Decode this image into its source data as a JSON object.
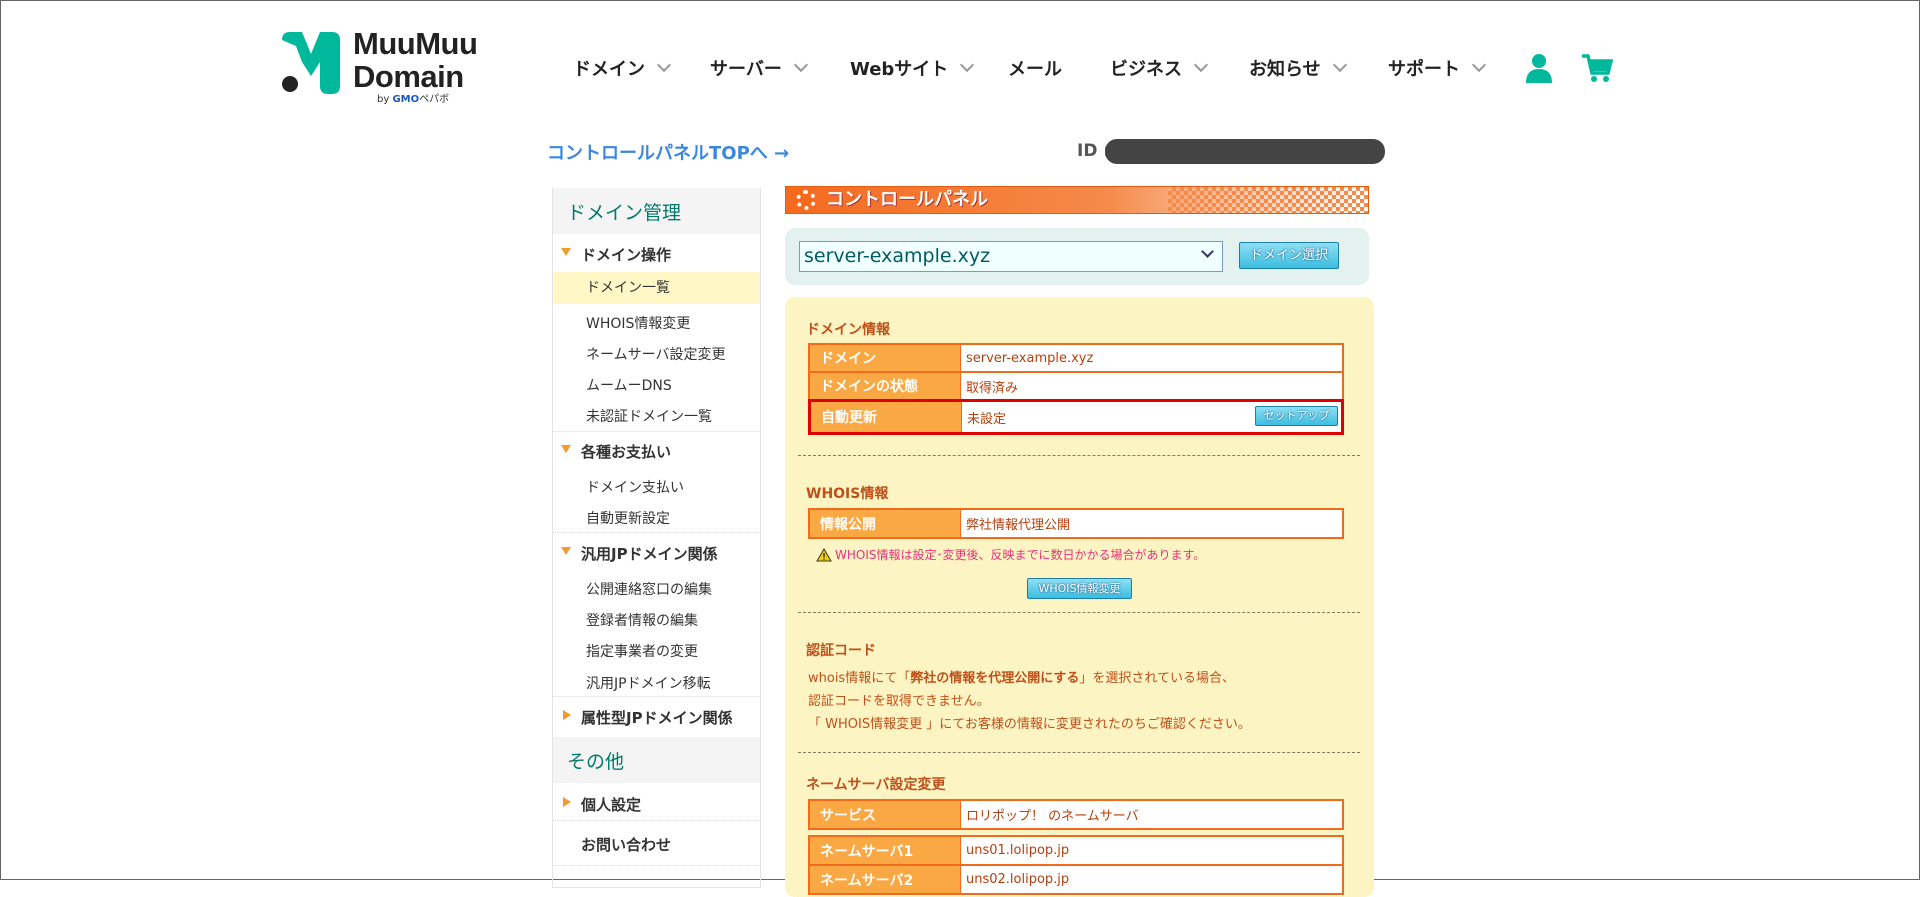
{
  "brand": {
    "line1": "MuuMuu",
    "line2": "Domain",
    "by": "by",
    "gmo": "GMO",
    "pepabo": "ペパボ"
  },
  "nav": [
    {
      "label": "ドメイン",
      "chevron": true
    },
    {
      "label": "サーバー",
      "chevron": true
    },
    {
      "label": "Webサイト",
      "chevron": true
    },
    {
      "label": "メール",
      "chevron": false
    },
    {
      "label": "ビジネス",
      "chevron": true
    },
    {
      "label": "お知らせ",
      "chevron": true
    },
    {
      "label": "サポート",
      "chevron": true
    }
  ],
  "top_link": "コントロールパネルTOPへ →",
  "id_label": "ID :",
  "sidebar": {
    "header1": "ドメイン管理",
    "group1": "ドメイン操作",
    "group1_items": [
      "ドメイン一覧",
      "WHOIS情報変更",
      "ネームサーバ設定変更",
      "ムームーDNS",
      "未認証ドメイン一覧"
    ],
    "group2": "各種お支払い",
    "group2_items": [
      "ドメイン支払い",
      "自動更新設定"
    ],
    "group3": "汎用JPドメイン関係",
    "group3_items": [
      "公開連絡窓口の編集",
      "登録者情報の編集",
      "指定事業者の変更",
      "汎用JPドメイン移転"
    ],
    "group4": "属性型JPドメイン関係",
    "header2": "その他",
    "group5": "個人設定",
    "contact": "お問い合わせ"
  },
  "banner": "コントロールパネル",
  "domain_select": {
    "value": "server-example.xyz",
    "button": "ドメイン選択"
  },
  "domain_info": {
    "title": "ドメイン情報",
    "rows": [
      {
        "label": "ドメイン",
        "value": "server-example.xyz"
      },
      {
        "label": "ドメインの状態",
        "value": "取得済み"
      },
      {
        "label": "自動更新",
        "value": "未設定",
        "button": "セットアップ"
      }
    ]
  },
  "whois": {
    "title": "WHOIS情報",
    "label": "情報公開",
    "value": "弊社情報代理公開",
    "warning": "WHOIS情報は設定･変更後、反映までに数日かかる場合があります。",
    "button": "WHOIS情報変更"
  },
  "auth": {
    "title": "認証コード",
    "l1a": "whois情報にて「",
    "l1b": "弊社の情報を代理公開にする",
    "l1c": "」を選択されている場合、",
    "l2": "認証コードを取得できません。",
    "l3": "「 WHOIS情報変更 」にてお客様の情報に変更されたのちご確認ください。"
  },
  "ns": {
    "title": "ネームサーバ設定変更",
    "service_label": "サービス",
    "service_value": "ロリポップ！ のネームサーバ",
    "rows": [
      {
        "label": "ネームサーバ1",
        "value": "uns01.lolipop.jp"
      },
      {
        "label": "ネームサーバ2",
        "value": "uns02.lolipop.jp"
      }
    ]
  },
  "colors": {
    "teal": "#00b89c",
    "orange": "#f26b1d",
    "highlight": "#e00000"
  }
}
